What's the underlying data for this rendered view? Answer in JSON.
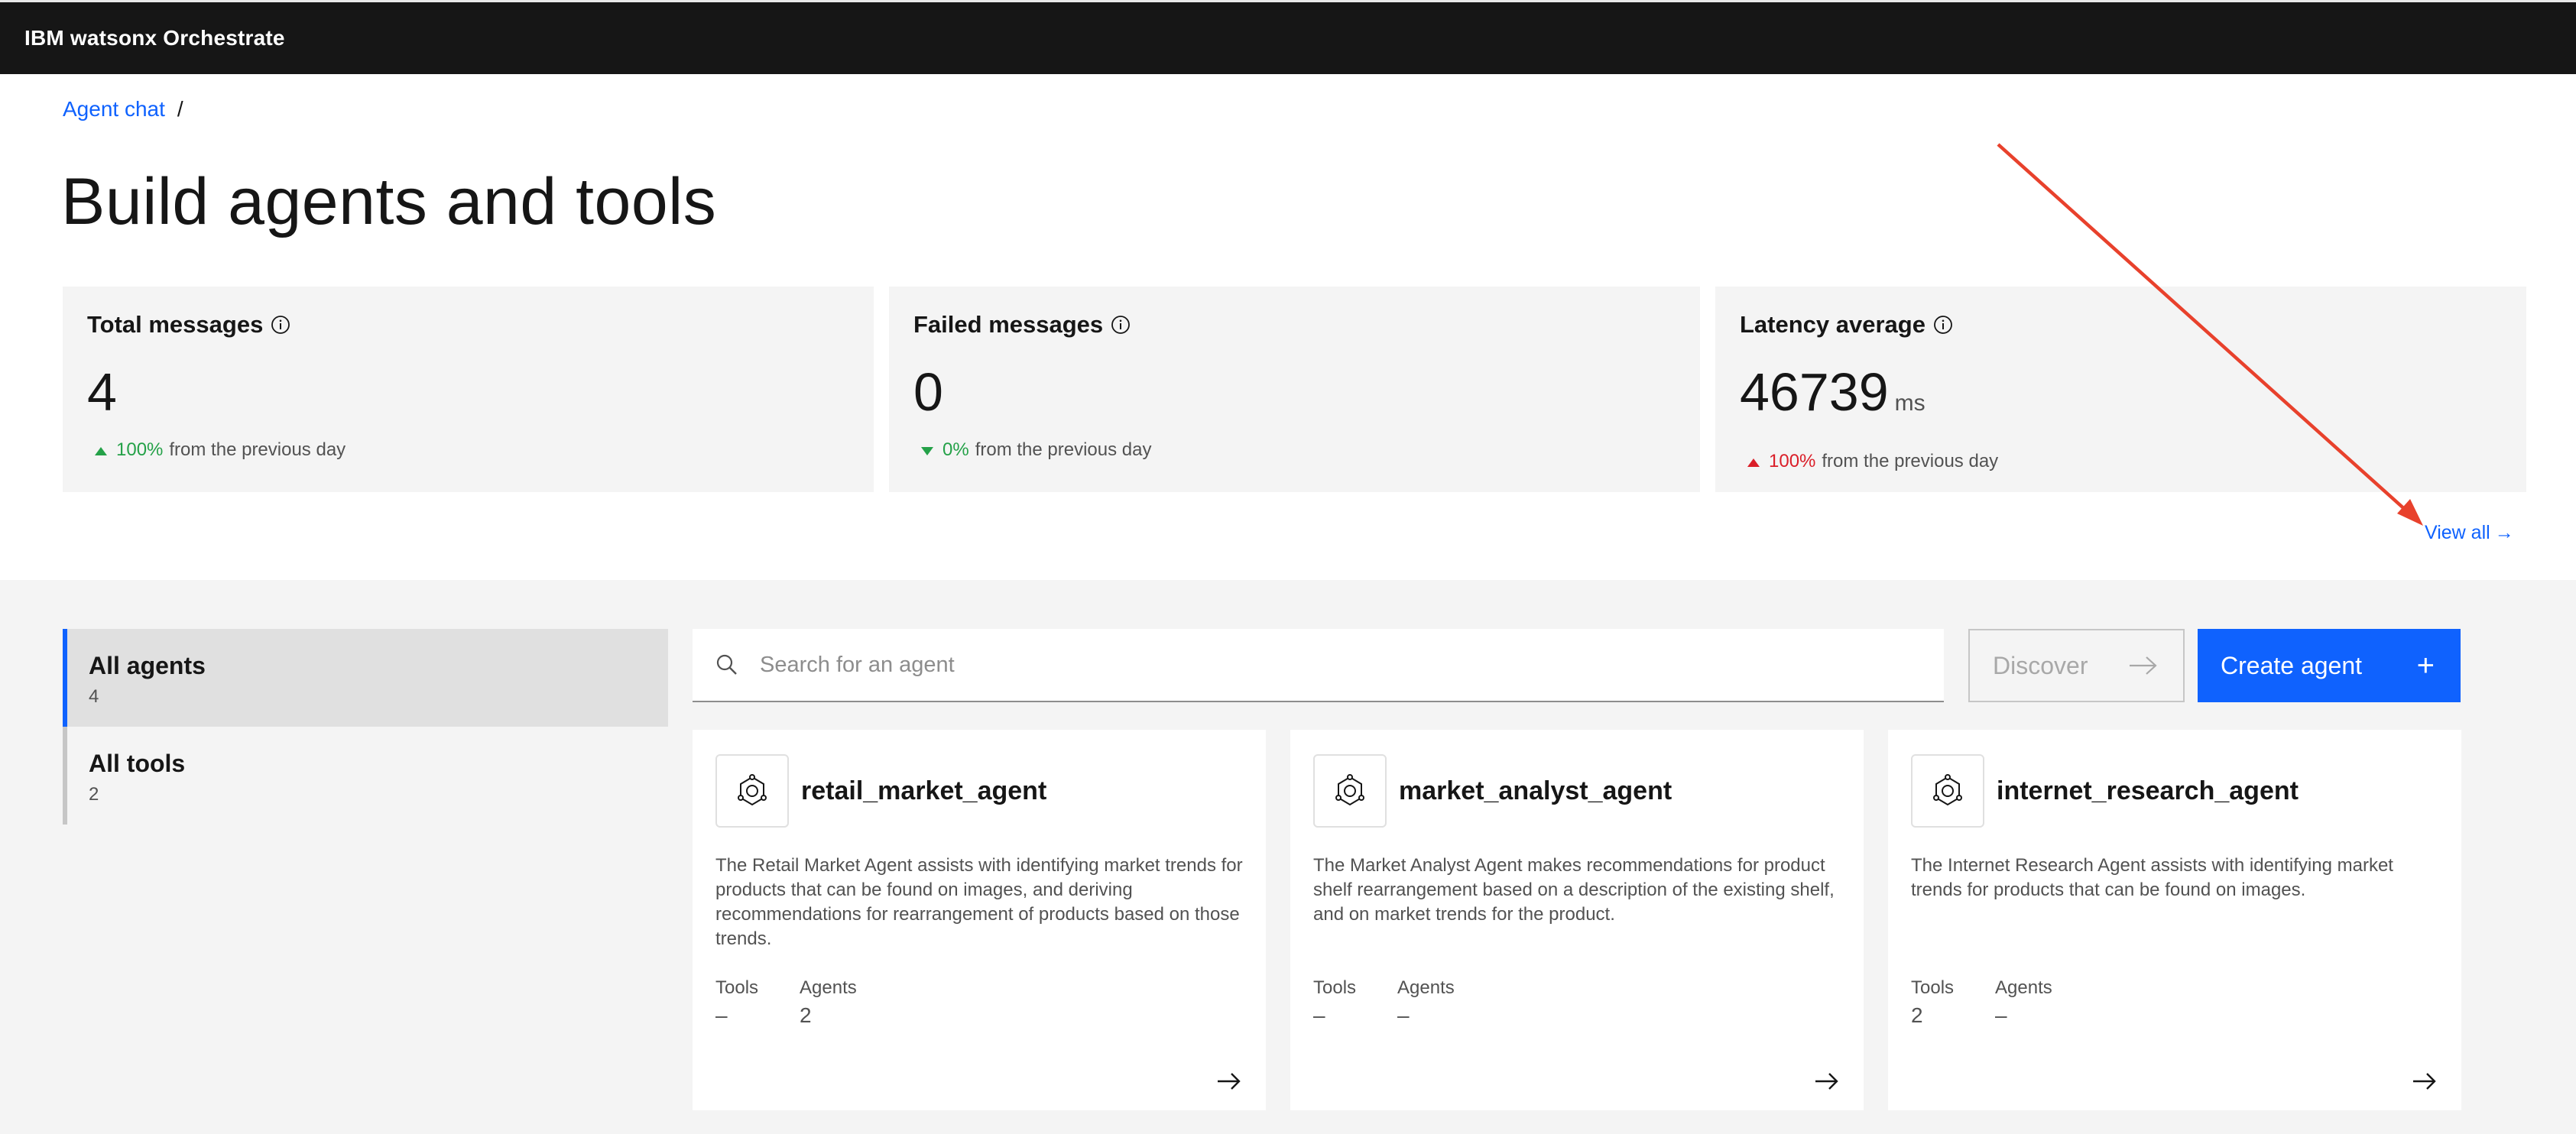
{
  "app": {
    "brand": "IBM watsonx Orchestrate"
  },
  "breadcrumb": {
    "link": "Agent chat",
    "separator": "/"
  },
  "page": {
    "title": "Build agents and tools"
  },
  "metrics": [
    {
      "label": "Total messages",
      "value": "4",
      "unit": "",
      "trend_dir": "up",
      "trend_pct": "100%",
      "trend_text": "from the previous day",
      "trend_color": "#24a148"
    },
    {
      "label": "Failed messages",
      "value": "0",
      "unit": "",
      "trend_dir": "down",
      "trend_pct": "0%",
      "trend_text": "from the previous day",
      "trend_color": "#24a148"
    },
    {
      "label": "Latency average",
      "value": "46739",
      "unit": "ms",
      "trend_dir": "up",
      "trend_pct": "100%",
      "trend_text": "from the previous day",
      "trend_color": "#da1e28"
    }
  ],
  "view_all": {
    "label": "View all",
    "arrow": "→"
  },
  "sidebar": {
    "items": [
      {
        "label": "All agents",
        "count": "4",
        "active": true
      },
      {
        "label": "All tools",
        "count": "2",
        "active": false
      }
    ]
  },
  "search": {
    "placeholder": "Search for an agent"
  },
  "buttons": {
    "discover": "Discover",
    "create": "Create agent",
    "create_icon": "+"
  },
  "cards": [
    {
      "name": "retail_market_agent",
      "description": "The Retail Market Agent assists with identifying market trends for products that can be found on images, and deriving recommendations for rearrangement of products based on those trends.",
      "tools_label": "Tools",
      "tools": "–",
      "agents_label": "Agents",
      "agents": "2"
    },
    {
      "name": "market_analyst_agent",
      "description": "The Market Analyst Agent makes recommendations for product shelf rearrangement based on a description of the existing shelf, and on market trends for the product.",
      "tools_label": "Tools",
      "tools": "–",
      "agents_label": "Agents",
      "agents": "–"
    },
    {
      "name": "internet_research_agent",
      "description": "The Internet Research Agent assists with identifying market trends for products that can be found on images.",
      "tools_label": "Tools",
      "tools": "2",
      "agents_label": "Agents",
      "agents": "–"
    }
  ],
  "colors": {
    "accent": "#0f62fe",
    "annotation_arrow": "#e8412c",
    "topbar": "#161616"
  }
}
